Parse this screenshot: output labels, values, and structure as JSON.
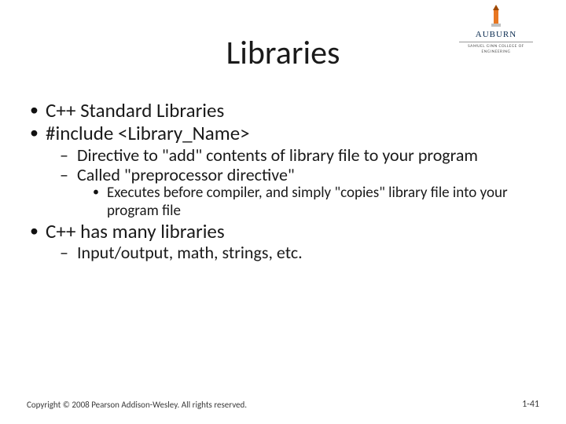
{
  "logo": {
    "name": "AUBURN",
    "subline": "SAMUEL GINN COLLEGE OF ENGINEERING"
  },
  "title": "Libraries",
  "bullets": [
    {
      "text": "C++ Standard Libraries"
    },
    {
      "text": "#include <Library_Name>",
      "children": [
        {
          "text": "Directive to \"add\" contents of library file to your program"
        },
        {
          "text": "Called \"preprocessor directive\"",
          "children": [
            {
              "text": "Executes before compiler, and simply \"copies\" library file into your program file"
            }
          ]
        }
      ]
    },
    {
      "text": "C++ has many libraries",
      "children": [
        {
          "text": "Input/output, math, strings, etc."
        }
      ]
    }
  ],
  "footer": {
    "copyright": "Copyright © 2008 Pearson Addison-Wesley. All rights reserved.",
    "pagenum": "1-41"
  }
}
